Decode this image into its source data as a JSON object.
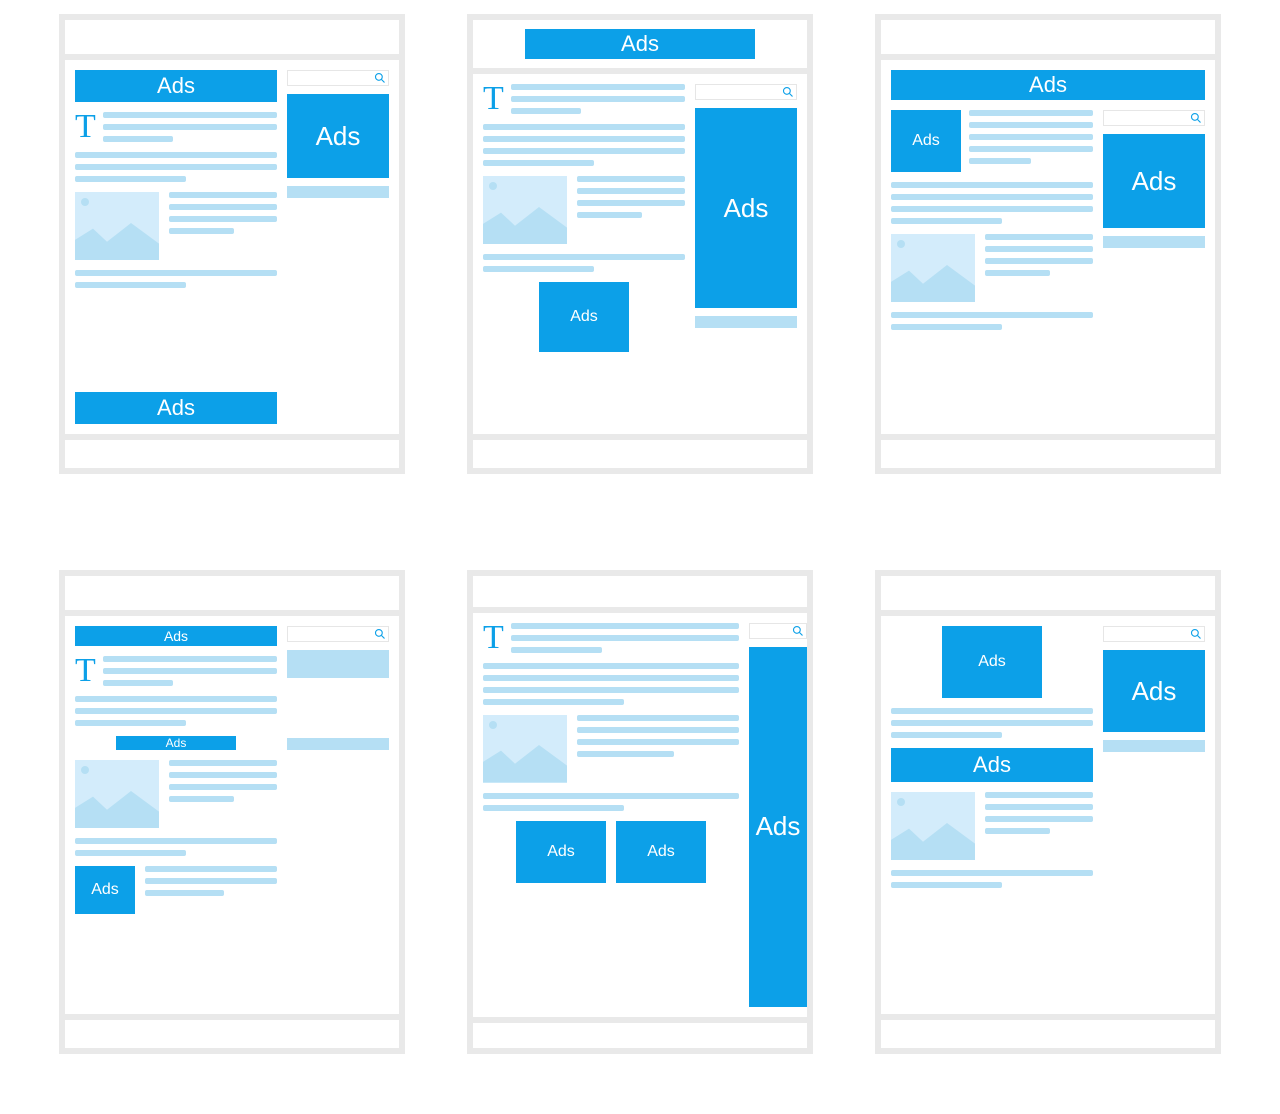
{
  "labels": {
    "ads": "Ads"
  },
  "colors": {
    "accent": "#0ca0e8",
    "paleLine": "#b5dff4",
    "paleFill": "#d3ecfb",
    "border": "#e9e9e9"
  },
  "layouts": [
    {
      "name": "layout-1",
      "ads": [
        "banner-top",
        "sidebar-square",
        "banner-bottom"
      ]
    },
    {
      "name": "layout-2",
      "ads": [
        "banner-header",
        "sidebar-tall",
        "inline-square"
      ]
    },
    {
      "name": "layout-3",
      "ads": [
        "banner-top",
        "square-left",
        "sidebar-square"
      ]
    },
    {
      "name": "layout-4",
      "ads": [
        "thin-top",
        "inline-thin",
        "thumb-ad"
      ]
    },
    {
      "name": "layout-5",
      "ads": [
        "sidebar-skyscraper",
        "square-left",
        "square-right"
      ]
    },
    {
      "name": "layout-6",
      "ads": [
        "sidebar-square",
        "inline-square",
        "banner-mid"
      ]
    }
  ]
}
